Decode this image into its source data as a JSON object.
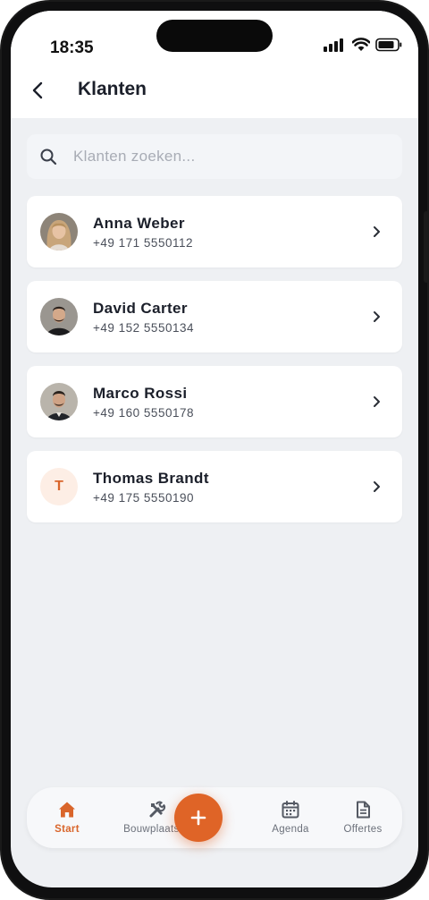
{
  "status_bar": {
    "time": "18:35"
  },
  "header": {
    "title": "Klanten"
  },
  "search": {
    "placeholder": "Klanten zoeken..."
  },
  "customers": [
    {
      "name": "Anna Weber",
      "phone": "+49 171 5550112",
      "avatar": "photo"
    },
    {
      "name": "David Carter",
      "phone": "+49 152 5550134",
      "avatar": "photo"
    },
    {
      "name": "Marco Rossi",
      "phone": "+49 160 5550178",
      "avatar": "photo"
    },
    {
      "name": "Thomas Brandt",
      "phone": "+49 175 5550190",
      "avatar": "initial",
      "initial": "T"
    }
  ],
  "tabbar": {
    "tabs": [
      {
        "label": "Start",
        "icon": "home-icon",
        "active": true
      },
      {
        "label": "Bouwplaatsen",
        "icon": "tools-icon",
        "active": false
      },
      {
        "label": "Agenda",
        "icon": "calendar-icon",
        "active": false
      },
      {
        "label": "Offertes",
        "icon": "document-icon",
        "active": false
      }
    ],
    "fab_icon": "plus-icon"
  },
  "colors": {
    "accent": "#df6427",
    "background": "#eef0f3",
    "card": "#ffffff"
  }
}
